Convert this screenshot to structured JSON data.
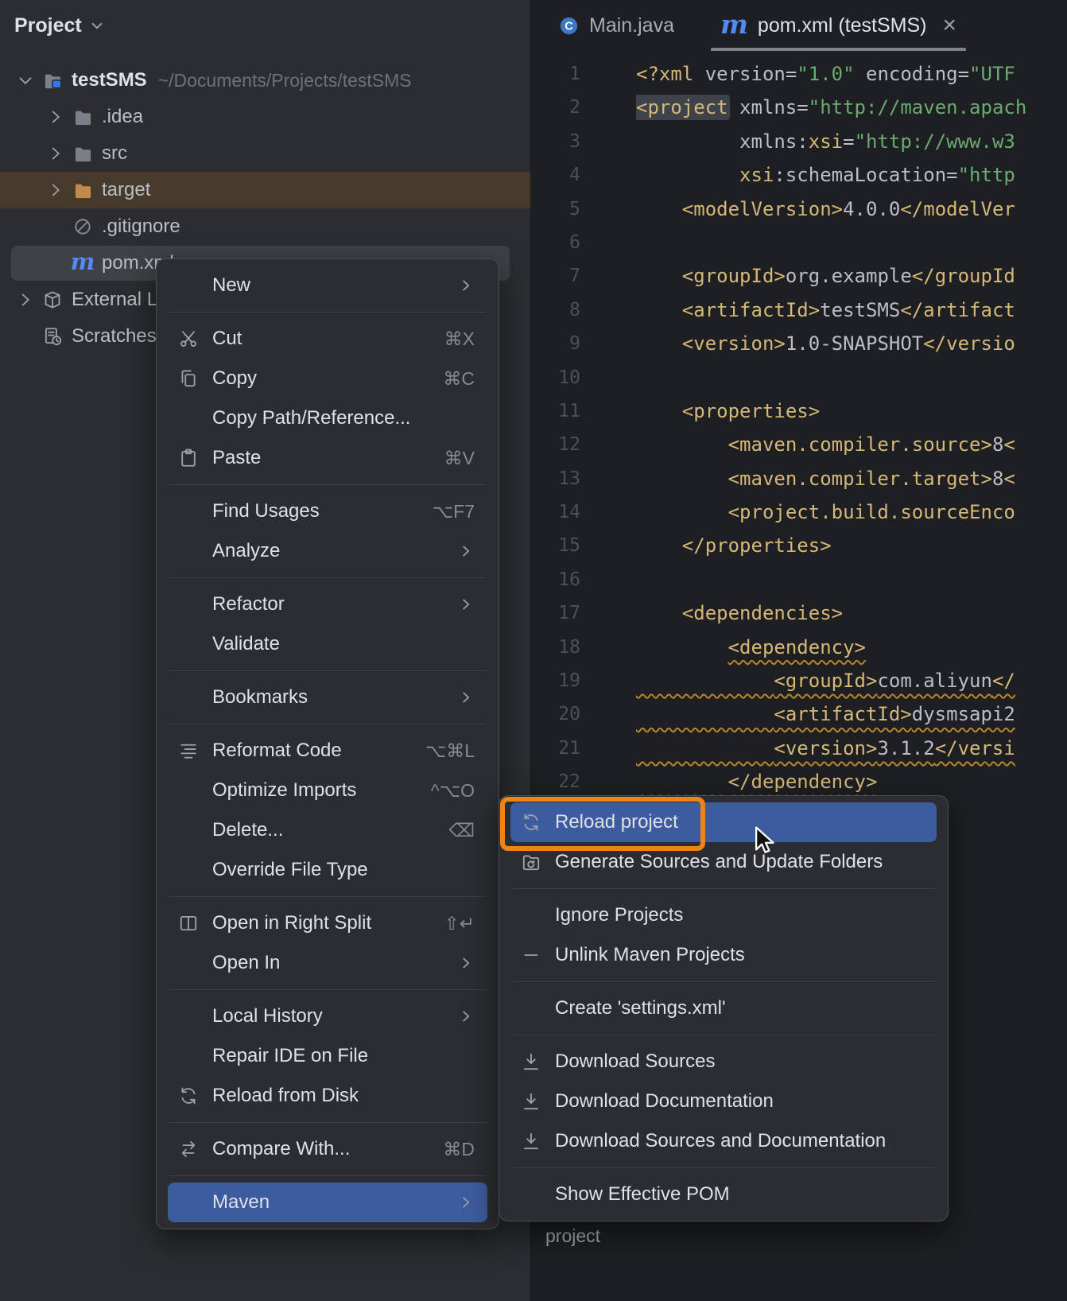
{
  "colors": {
    "annotation_orange": "#EC8416",
    "menu_selection_blue": "#3D5C9F",
    "excluded_row_brown": "#453A2B",
    "selected_row_gray": "#3E4146",
    "maven_blue": "#548AF7",
    "tag_gold": "#D5B778",
    "string_green": "#6AAB73",
    "warning_squiggle": "#B6862C"
  },
  "project_panel": {
    "title": "Project",
    "tree": [
      {
        "id": "testsms",
        "chevron": "down",
        "icon": "project-folder-icon",
        "label": "testSMS",
        "detail": "~/Documents/Projects/testSMS",
        "indent": 0,
        "bold": true
      },
      {
        "id": "idea",
        "chevron": "right",
        "icon": "folder-icon",
        "label": ".idea",
        "indent": 1
      },
      {
        "id": "src",
        "chevron": "right",
        "icon": "folder-icon",
        "label": "src",
        "indent": 1
      },
      {
        "id": "target",
        "chevron": "right",
        "icon": "excluded-folder-icon",
        "label": "target",
        "indent": 1,
        "highlight": "excluded"
      },
      {
        "id": "gitignore",
        "icon": "ignored-file-icon",
        "label": ".gitignore",
        "indent": 1
      },
      {
        "id": "pom-xml",
        "icon": "maven-file-icon",
        "label": "pom.xml",
        "indent": 1,
        "highlight": "selected"
      },
      {
        "id": "external-libraries",
        "chevron": "right",
        "icon": "libraries-icon",
        "label": "External Libraries",
        "indent": 0
      },
      {
        "id": "scratches",
        "icon": "scratches-icon",
        "label": "Scratches and Consoles",
        "indent": 0
      }
    ]
  },
  "editor": {
    "tabs": [
      {
        "id": "main-java",
        "icon": "java-class-icon",
        "label": "Main.java",
        "active": false
      },
      {
        "id": "pom-xml",
        "icon": "maven-icon",
        "label": "pom.xml (testSMS)",
        "active": true,
        "closable": true,
        "close_glyph": "×"
      }
    ],
    "breadcrumb": "project",
    "code": {
      "lines": [
        {
          "segs": [
            [
              "tag",
              "<?xml "
            ],
            [
              "attr",
              "version="
            ],
            [
              "str",
              "\"1.0\""
            ],
            [
              "attr",
              " encoding="
            ],
            [
              "str",
              "\"UTF"
            ]
          ]
        },
        {
          "segs": [
            [
              "tag hl",
              "<project"
            ],
            [
              "plain",
              " "
            ],
            [
              "attr",
              "xmlns="
            ],
            [
              "str",
              "\"http://maven.apach"
            ]
          ]
        },
        {
          "segs": [
            [
              "plain",
              "         "
            ],
            [
              "attr",
              "xmlns:"
            ],
            [
              "tag",
              "xsi"
            ],
            [
              "attr",
              "="
            ],
            [
              "str",
              "\"http://www.w3"
            ]
          ]
        },
        {
          "segs": [
            [
              "plain",
              "         "
            ],
            [
              "tag",
              "xsi"
            ],
            [
              "attr",
              ":schemaLocation="
            ],
            [
              "str",
              "\"http"
            ]
          ]
        },
        {
          "segs": [
            [
              "plain",
              "    "
            ],
            [
              "tag",
              "<modelVersion>"
            ],
            [
              "plain",
              "4.0.0"
            ],
            [
              "tag",
              "</modelVer"
            ]
          ]
        },
        {
          "segs": []
        },
        {
          "segs": [
            [
              "plain",
              "    "
            ],
            [
              "tag",
              "<groupId>"
            ],
            [
              "plain",
              "org.example"
            ],
            [
              "tag",
              "</groupId"
            ]
          ]
        },
        {
          "segs": [
            [
              "plain",
              "    "
            ],
            [
              "tag",
              "<artifactId>"
            ],
            [
              "plain",
              "testSMS"
            ],
            [
              "tag",
              "</artifact"
            ]
          ]
        },
        {
          "segs": [
            [
              "plain",
              "    "
            ],
            [
              "tag",
              "<version>"
            ],
            [
              "plain",
              "1.0-SNAPSHOT"
            ],
            [
              "tag",
              "</versio"
            ]
          ]
        },
        {
          "segs": []
        },
        {
          "segs": [
            [
              "plain",
              "    "
            ],
            [
              "tag",
              "<properties>"
            ]
          ]
        },
        {
          "segs": [
            [
              "plain",
              "        "
            ],
            [
              "tag",
              "<maven.compiler.source>"
            ],
            [
              "plain",
              "8"
            ],
            [
              "tag",
              "<"
            ]
          ]
        },
        {
          "segs": [
            [
              "plain",
              "        "
            ],
            [
              "tag",
              "<maven.compiler.target>"
            ],
            [
              "plain",
              "8"
            ],
            [
              "tag",
              "<"
            ]
          ]
        },
        {
          "segs": [
            [
              "plain",
              "        "
            ],
            [
              "tag",
              "<project.build.sourceEnco"
            ]
          ]
        },
        {
          "segs": [
            [
              "plain",
              "    "
            ],
            [
              "tag",
              "</properties>"
            ]
          ]
        },
        {
          "segs": []
        },
        {
          "segs": [
            [
              "plain",
              "    "
            ],
            [
              "tag",
              "<dependencies>"
            ]
          ]
        },
        {
          "segs": [
            [
              "plain",
              "        "
            ],
            [
              "tag wavy",
              "<dependency>"
            ]
          ]
        },
        {
          "segs": [
            [
              "plain wavy",
              "            "
            ],
            [
              "tag wavy",
              "<groupId>"
            ],
            [
              "plain wavy",
              "com.aliyun"
            ],
            [
              "tag wavy",
              "</"
            ]
          ]
        },
        {
          "segs": [
            [
              "plain wavy",
              "            "
            ],
            [
              "tag wavy",
              "<artifactId>"
            ],
            [
              "plain wavy",
              "dysmsapi2"
            ]
          ]
        },
        {
          "segs": [
            [
              "plain wavy",
              "            "
            ],
            [
              "tag wavy",
              "<version>"
            ],
            [
              "plain wavy",
              "3.1.2"
            ],
            [
              "tag wavy",
              "</versi"
            ]
          ]
        },
        {
          "segs": [
            [
              "plain wavy",
              "        "
            ],
            [
              "tag wavy",
              "</dependency>"
            ]
          ]
        }
      ]
    }
  },
  "context_menu": {
    "items": [
      {
        "type": "item",
        "label": "New",
        "submenu": true
      },
      {
        "type": "separator"
      },
      {
        "type": "item",
        "icon": "scissors-icon",
        "label": "Cut",
        "shortcut": "⌘X"
      },
      {
        "type": "item",
        "icon": "copy-icon",
        "label": "Copy",
        "shortcut": "⌘C"
      },
      {
        "type": "item",
        "label": "Copy Path/Reference..."
      },
      {
        "type": "item",
        "icon": "paste-icon",
        "label": "Paste",
        "shortcut": "⌘V"
      },
      {
        "type": "separator"
      },
      {
        "type": "item",
        "label": "Find Usages",
        "shortcut": "⌥F7"
      },
      {
        "type": "item",
        "label": "Analyze",
        "submenu": true
      },
      {
        "type": "separator"
      },
      {
        "type": "item",
        "label": "Refactor",
        "submenu": true
      },
      {
        "type": "item",
        "label": "Validate"
      },
      {
        "type": "separator"
      },
      {
        "type": "item",
        "label": "Bookmarks",
        "submenu": true
      },
      {
        "type": "separator"
      },
      {
        "type": "item",
        "icon": "reformat-code-icon",
        "label": "Reformat Code",
        "shortcut": "⌥⌘L"
      },
      {
        "type": "item",
        "label": "Optimize Imports",
        "shortcut": "^⌥O"
      },
      {
        "type": "item",
        "label": "Delete...",
        "shortcut": "⌫"
      },
      {
        "type": "item",
        "label": "Override File Type"
      },
      {
        "type": "separator"
      },
      {
        "type": "item",
        "icon": "split-right-icon",
        "label": "Open in Right Split",
        "shortcut": "⇧↵"
      },
      {
        "type": "item",
        "label": "Open In",
        "submenu": true
      },
      {
        "type": "separator"
      },
      {
        "type": "item",
        "label": "Local History",
        "submenu": true
      },
      {
        "type": "item",
        "label": "Repair IDE on File"
      },
      {
        "type": "item",
        "icon": "reload-icon",
        "label": "Reload from Disk"
      },
      {
        "type": "separator"
      },
      {
        "type": "item",
        "icon": "compare-icon",
        "label": "Compare With...",
        "shortcut": "⌘D"
      },
      {
        "type": "separator"
      },
      {
        "type": "item",
        "label": "Maven",
        "submenu": true,
        "selected": true
      }
    ]
  },
  "maven_submenu": {
    "items": [
      {
        "type": "item",
        "icon": "reload-icon",
        "label": "Reload project",
        "selected": true,
        "annotated": true
      },
      {
        "type": "item",
        "icon": "generate-sources-icon",
        "label": "Generate Sources and Update Folders"
      },
      {
        "type": "separator"
      },
      {
        "type": "item",
        "label": "Ignore Projects"
      },
      {
        "type": "item",
        "icon": "unlink-icon",
        "label": "Unlink Maven Projects"
      },
      {
        "type": "separator"
      },
      {
        "type": "item",
        "label": "Create 'settings.xml'"
      },
      {
        "type": "separator"
      },
      {
        "type": "item",
        "icon": "download-icon",
        "label": "Download Sources"
      },
      {
        "type": "item",
        "icon": "download-icon",
        "label": "Download Documentation"
      },
      {
        "type": "item",
        "icon": "download-icon",
        "label": "Download Sources and Documentation"
      },
      {
        "type": "separator"
      },
      {
        "type": "item",
        "label": "Show Effective POM"
      }
    ]
  }
}
